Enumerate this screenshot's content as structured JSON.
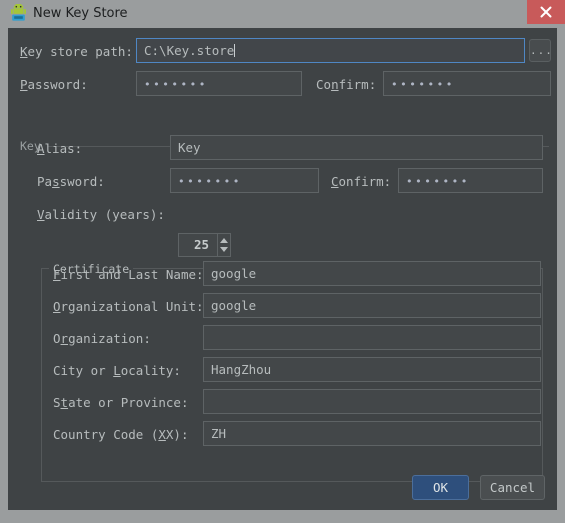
{
  "window": {
    "title": "New Key Store",
    "icon": "android-robot-icon",
    "close_label": "×",
    "frame_color": "#9a9d9e",
    "body_color": "#3f4345",
    "close_color": "#c85a5a"
  },
  "keystore": {
    "path_label_pre": "",
    "path_label_mnemonic": "K",
    "path_label_post": "ey store path:",
    "path_value": "C:\\Key.store",
    "browse_label": "...",
    "password_label_mnemonic": "P",
    "password_label_post": "assword:",
    "password_value": "•••••••",
    "confirm_label_pre": "Co",
    "confirm_label_mnemonic": "n",
    "confirm_label_post": "firm:",
    "confirm_value": "•••••••"
  },
  "key_group": {
    "title": "Key",
    "alias_label_mnemonic": "A",
    "alias_label_post": "lias:",
    "alias_value": "Key",
    "password_label_pre": "Pa",
    "password_label_mnemonic": "s",
    "password_label_post": "sword:",
    "password_value": "•••••••",
    "confirm_label_mnemonic": "C",
    "confirm_label_post": "onfirm:",
    "confirm_value": "•••••••",
    "validity_label_mnemonic": "V",
    "validity_label_post": "alidity (years):",
    "validity_value": "25"
  },
  "certificate_group": {
    "title": "Certificate",
    "fields": [
      {
        "label_pre": "",
        "label_mnemonic": "F",
        "label_post": "irst and Last Name:",
        "value": "google",
        "name": "first-and-last-name"
      },
      {
        "label_pre": "",
        "label_mnemonic": "O",
        "label_post": "rganizational Unit:",
        "value": "google",
        "name": "organizational-unit"
      },
      {
        "label_pre": "O",
        "label_mnemonic": "r",
        "label_post": "ganization:",
        "value": "",
        "name": "organization"
      },
      {
        "label_pre": "City or ",
        "label_mnemonic": "L",
        "label_post": "ocality:",
        "value": "HangZhou",
        "name": "city-or-locality"
      },
      {
        "label_pre": "S",
        "label_mnemonic": "t",
        "label_post": "ate or Province:",
        "value": "",
        "name": "state-or-province"
      },
      {
        "label_pre": "Country Code (",
        "label_mnemonic": "X",
        "label_post": "X):",
        "value": "ZH",
        "name": "country-code"
      }
    ]
  },
  "footer": {
    "ok_label": "OK",
    "cancel_label": "Cancel",
    "ok_color": "#2e4f7c"
  }
}
